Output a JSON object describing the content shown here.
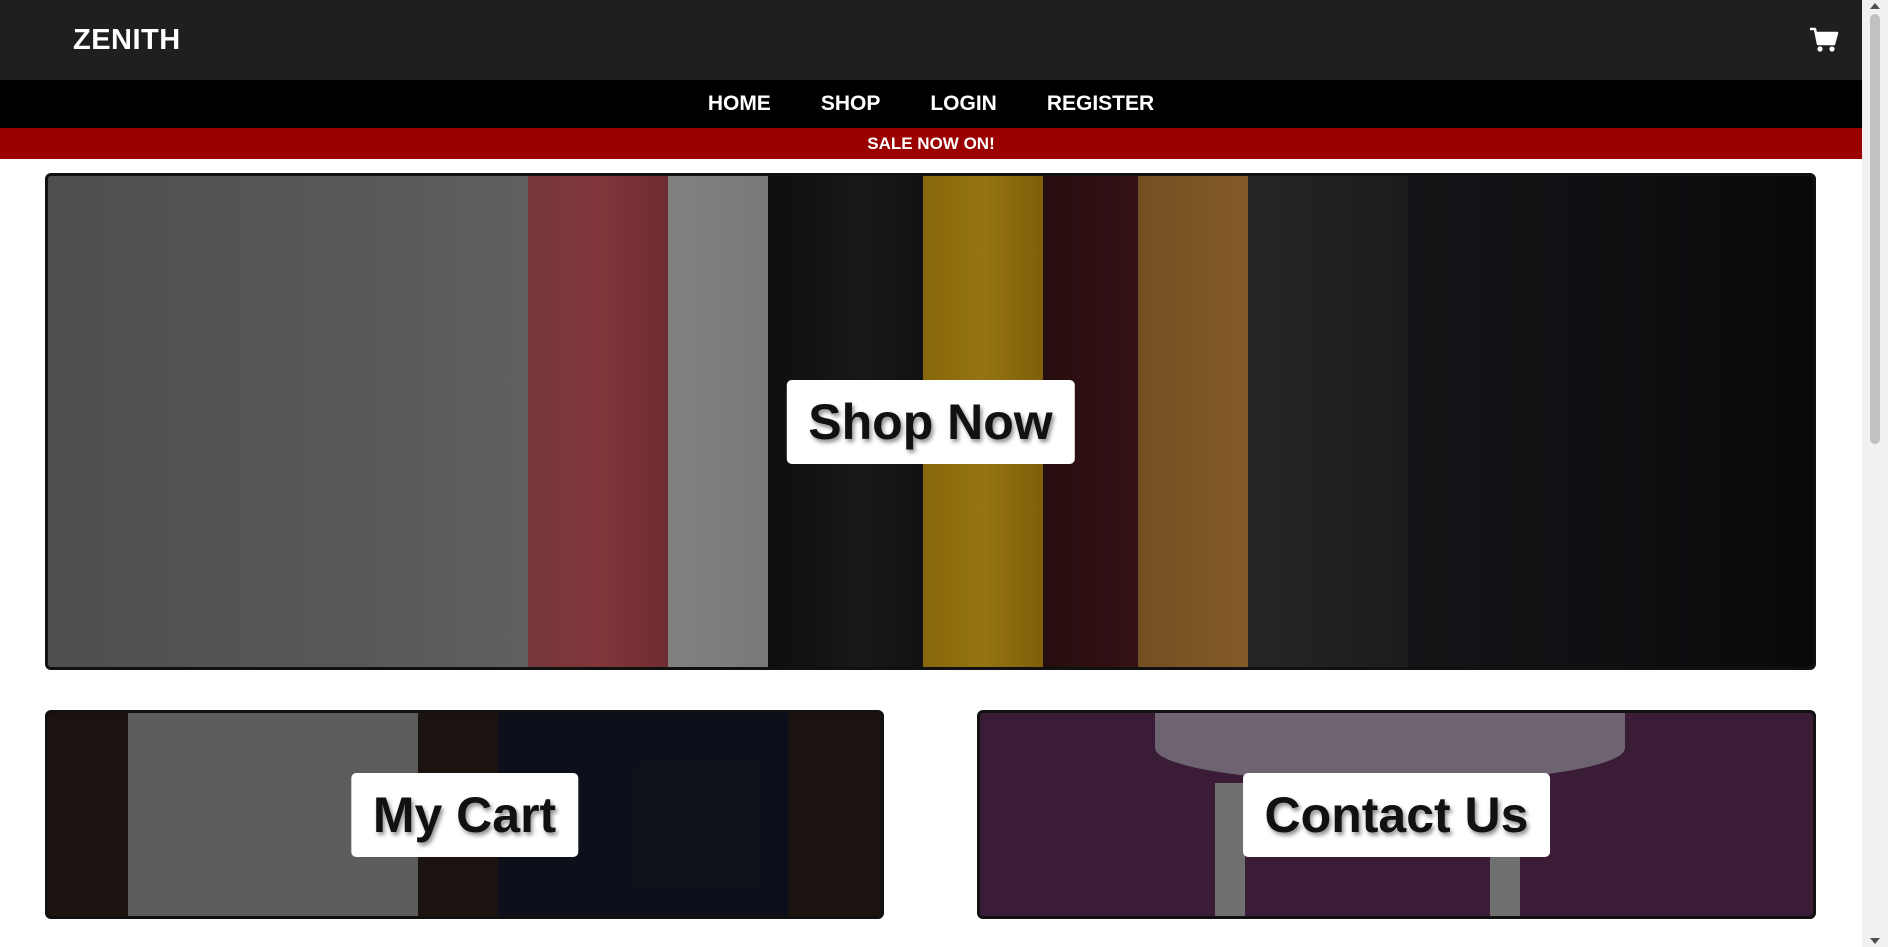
{
  "header": {
    "brand": "ZENITH",
    "cart_icon": "shopping-cart-icon"
  },
  "nav": {
    "items": [
      {
        "label": "HOME"
      },
      {
        "label": "SHOP"
      },
      {
        "label": "LOGIN"
      },
      {
        "label": "REGISTER"
      }
    ]
  },
  "banner": {
    "text": "SALE NOW ON!"
  },
  "hero": {
    "button_label": "Shop Now"
  },
  "tiles": {
    "cart_label": "My Cart",
    "contact_label": "Contact Us"
  },
  "colors": {
    "topbar": "#1f1f1f",
    "navbar": "#000000",
    "sale_banner": "#9a0000"
  }
}
